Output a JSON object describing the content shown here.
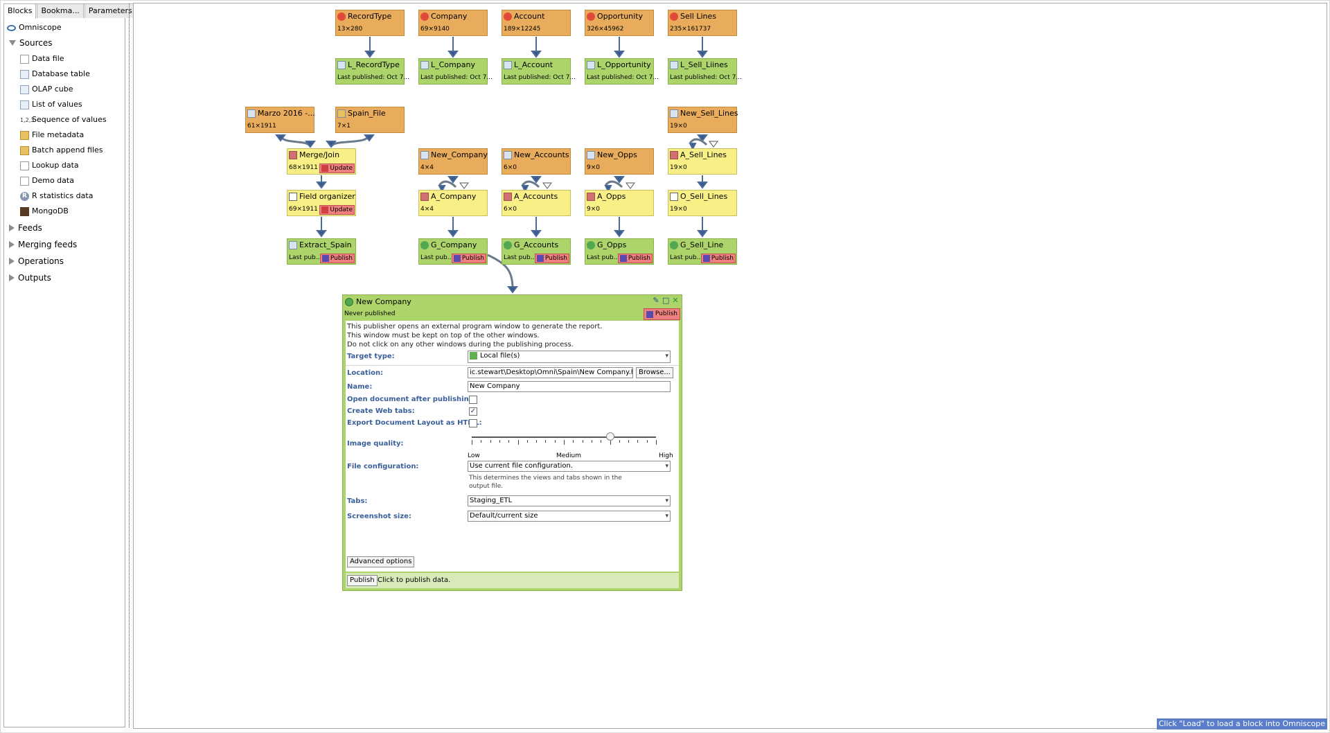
{
  "left_panel": {
    "tabs": [
      "Blocks",
      "Bookma...",
      "Parameters"
    ],
    "omniscope": "Omniscope",
    "sources": {
      "label": "Sources",
      "items": [
        "Data file",
        "Database table",
        "OLAP cube",
        "List of values",
        "Sequence of values",
        "File metadata",
        "Batch append files",
        "Lookup data",
        "Demo data",
        "R statistics data",
        "MongoDB"
      ],
      "seq_prefix": "1,2,3"
    },
    "categories": [
      "Feeds",
      "Merging feeds",
      "Operations",
      "Outputs"
    ]
  },
  "blocks": {
    "recordtype": {
      "title": "RecordType",
      "sub": "13×280"
    },
    "company": {
      "title": "Company",
      "sub": "69×9140"
    },
    "account": {
      "title": "Account",
      "sub": "189×12245"
    },
    "opportunity": {
      "title": "Opportunity",
      "sub": "326×45962"
    },
    "sell_lines": {
      "title": "Sell Lines",
      "sub": "235×161737"
    },
    "l_recordtype": {
      "title": "L_RecordType",
      "sub": "Last published: Oct 7..."
    },
    "l_company": {
      "title": "L_Company",
      "sub": "Last published: Oct 7..."
    },
    "l_account": {
      "title": "L_Account",
      "sub": "Last published: Oct 7..."
    },
    "l_opportunity": {
      "title": "L_Opportunity",
      "sub": "Last published: Oct 7..."
    },
    "l_sell_liines": {
      "title": "L_Sell_Liines",
      "sub": "Last published: Oct 7..."
    },
    "marzo": {
      "title": "Marzo 2016 -...",
      "sub": "61×1911"
    },
    "spain_file": {
      "title": "Spain_File",
      "sub": "7×1"
    },
    "new_sell_lines": {
      "title": "New_Sell_Lines",
      "sub": "19×0"
    },
    "merge_join": {
      "title": "Merge/Join",
      "sub": "68×1911",
      "badge": "Update"
    },
    "new_company": {
      "title": "New_Company",
      "sub": "4×4"
    },
    "new_accounts": {
      "title": "New_Accounts",
      "sub": "6×0"
    },
    "new_opps": {
      "title": "New_Opps",
      "sub": "9×0"
    },
    "a_sell_lines": {
      "title": "A_Sell_Lines",
      "sub": "19×0"
    },
    "field_organizer": {
      "title": "Field organizer",
      "sub": "69×1911",
      "badge": "Update"
    },
    "a_company": {
      "title": "A_Company",
      "sub": "4×4"
    },
    "a_accounts": {
      "title": "A_Accounts",
      "sub": "6×0"
    },
    "a_opps": {
      "title": "A_Opps",
      "sub": "9×0"
    },
    "o_sell_lines": {
      "title": "O_Sell_Lines",
      "sub": "19×0"
    },
    "extract_spain": {
      "title": "Extract_Spain",
      "sub": "Last pub...",
      "badge": "Publish"
    },
    "g_company": {
      "title": "G_Company",
      "sub": "Last pub...",
      "badge": "Publish"
    },
    "g_accounts": {
      "title": "G_Accounts",
      "sub": "Last pub...",
      "badge": "Publish"
    },
    "g_opps": {
      "title": "G_Opps",
      "sub": "Last pub...",
      "badge": "Publish"
    },
    "g_sell_line": {
      "title": "G_Sell_Line",
      "sub": "Last pub...",
      "badge": "Publish"
    }
  },
  "publisher": {
    "title": "New Company",
    "subtitle": "Never published",
    "publish_badge": "Publish",
    "desc_1": "This publisher opens an external program window to generate the report.",
    "desc_2": "This window must be kept on top of the other windows.",
    "desc_3": "Do not click on any other windows during the publishing process.",
    "target_type_label": "Target type:",
    "target_type_value": "Local file(s)",
    "location_label": "Location:",
    "location_value": "ic.stewart\\Desktop\\Omni\\Spain\\New Company.html",
    "browse_label": "Browse...",
    "name_label": "Name:",
    "name_value": "New Company",
    "open_doc_label": "Open document after publishing:",
    "open_doc_checked": false,
    "web_tabs_label": "Create Web tabs:",
    "web_tabs_checked": true,
    "export_layout_label": "Export Document Layout as HTML:",
    "export_layout_checked": false,
    "image_quality_label": "Image quality:",
    "image_quality_level": 0.75,
    "iq_low": "Low",
    "iq_medium": "Medium",
    "iq_high": "High",
    "file_config_label": "File configuration:",
    "file_config_value": "Use current file configuration.",
    "file_config_help_1": "This determines the views and tabs shown in the",
    "file_config_help_2": "output file.",
    "tabs_label": "Tabs:",
    "tabs_value": "Staging_ETL",
    "screenshot_label": "Screenshot size:",
    "screenshot_value": "Default/current size",
    "advanced_label": "Advanced options",
    "footer_button": "Publish",
    "footer_text": "Click to publish data."
  },
  "status_bar": "Click \"Load\" to load a block into Omniscope",
  "colors": {
    "source_block": "#e8ac5c",
    "publish_block": "#acd46a",
    "operation_block": "#f8f086",
    "badge": "#f08080",
    "label_blue": "#3a5f9a",
    "status_blue": "#5a7ec8"
  }
}
